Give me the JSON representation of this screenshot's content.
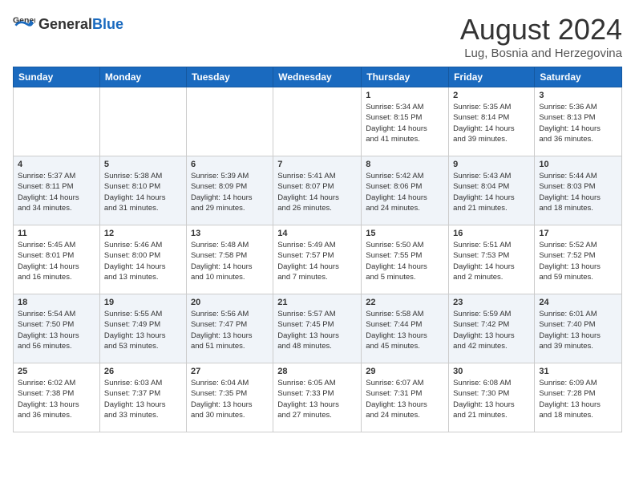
{
  "header": {
    "logo_general": "General",
    "logo_blue": "Blue",
    "month_year": "August 2024",
    "location": "Lug, Bosnia and Herzegovina"
  },
  "days_of_week": [
    "Sunday",
    "Monday",
    "Tuesday",
    "Wednesday",
    "Thursday",
    "Friday",
    "Saturday"
  ],
  "weeks": [
    [
      {
        "day": "",
        "content": ""
      },
      {
        "day": "",
        "content": ""
      },
      {
        "day": "",
        "content": ""
      },
      {
        "day": "",
        "content": ""
      },
      {
        "day": "1",
        "content": "Sunrise: 5:34 AM\nSunset: 8:15 PM\nDaylight: 14 hours\nand 41 minutes."
      },
      {
        "day": "2",
        "content": "Sunrise: 5:35 AM\nSunset: 8:14 PM\nDaylight: 14 hours\nand 39 minutes."
      },
      {
        "day": "3",
        "content": "Sunrise: 5:36 AM\nSunset: 8:13 PM\nDaylight: 14 hours\nand 36 minutes."
      }
    ],
    [
      {
        "day": "4",
        "content": "Sunrise: 5:37 AM\nSunset: 8:11 PM\nDaylight: 14 hours\nand 34 minutes."
      },
      {
        "day": "5",
        "content": "Sunrise: 5:38 AM\nSunset: 8:10 PM\nDaylight: 14 hours\nand 31 minutes."
      },
      {
        "day": "6",
        "content": "Sunrise: 5:39 AM\nSunset: 8:09 PM\nDaylight: 14 hours\nand 29 minutes."
      },
      {
        "day": "7",
        "content": "Sunrise: 5:41 AM\nSunset: 8:07 PM\nDaylight: 14 hours\nand 26 minutes."
      },
      {
        "day": "8",
        "content": "Sunrise: 5:42 AM\nSunset: 8:06 PM\nDaylight: 14 hours\nand 24 minutes."
      },
      {
        "day": "9",
        "content": "Sunrise: 5:43 AM\nSunset: 8:04 PM\nDaylight: 14 hours\nand 21 minutes."
      },
      {
        "day": "10",
        "content": "Sunrise: 5:44 AM\nSunset: 8:03 PM\nDaylight: 14 hours\nand 18 minutes."
      }
    ],
    [
      {
        "day": "11",
        "content": "Sunrise: 5:45 AM\nSunset: 8:01 PM\nDaylight: 14 hours\nand 16 minutes."
      },
      {
        "day": "12",
        "content": "Sunrise: 5:46 AM\nSunset: 8:00 PM\nDaylight: 14 hours\nand 13 minutes."
      },
      {
        "day": "13",
        "content": "Sunrise: 5:48 AM\nSunset: 7:58 PM\nDaylight: 14 hours\nand 10 minutes."
      },
      {
        "day": "14",
        "content": "Sunrise: 5:49 AM\nSunset: 7:57 PM\nDaylight: 14 hours\nand 7 minutes."
      },
      {
        "day": "15",
        "content": "Sunrise: 5:50 AM\nSunset: 7:55 PM\nDaylight: 14 hours\nand 5 minutes."
      },
      {
        "day": "16",
        "content": "Sunrise: 5:51 AM\nSunset: 7:53 PM\nDaylight: 14 hours\nand 2 minutes."
      },
      {
        "day": "17",
        "content": "Sunrise: 5:52 AM\nSunset: 7:52 PM\nDaylight: 13 hours\nand 59 minutes."
      }
    ],
    [
      {
        "day": "18",
        "content": "Sunrise: 5:54 AM\nSunset: 7:50 PM\nDaylight: 13 hours\nand 56 minutes."
      },
      {
        "day": "19",
        "content": "Sunrise: 5:55 AM\nSunset: 7:49 PM\nDaylight: 13 hours\nand 53 minutes."
      },
      {
        "day": "20",
        "content": "Sunrise: 5:56 AM\nSunset: 7:47 PM\nDaylight: 13 hours\nand 51 minutes."
      },
      {
        "day": "21",
        "content": "Sunrise: 5:57 AM\nSunset: 7:45 PM\nDaylight: 13 hours\nand 48 minutes."
      },
      {
        "day": "22",
        "content": "Sunrise: 5:58 AM\nSunset: 7:44 PM\nDaylight: 13 hours\nand 45 minutes."
      },
      {
        "day": "23",
        "content": "Sunrise: 5:59 AM\nSunset: 7:42 PM\nDaylight: 13 hours\nand 42 minutes."
      },
      {
        "day": "24",
        "content": "Sunrise: 6:01 AM\nSunset: 7:40 PM\nDaylight: 13 hours\nand 39 minutes."
      }
    ],
    [
      {
        "day": "25",
        "content": "Sunrise: 6:02 AM\nSunset: 7:38 PM\nDaylight: 13 hours\nand 36 minutes."
      },
      {
        "day": "26",
        "content": "Sunrise: 6:03 AM\nSunset: 7:37 PM\nDaylight: 13 hours\nand 33 minutes."
      },
      {
        "day": "27",
        "content": "Sunrise: 6:04 AM\nSunset: 7:35 PM\nDaylight: 13 hours\nand 30 minutes."
      },
      {
        "day": "28",
        "content": "Sunrise: 6:05 AM\nSunset: 7:33 PM\nDaylight: 13 hours\nand 27 minutes."
      },
      {
        "day": "29",
        "content": "Sunrise: 6:07 AM\nSunset: 7:31 PM\nDaylight: 13 hours\nand 24 minutes."
      },
      {
        "day": "30",
        "content": "Sunrise: 6:08 AM\nSunset: 7:30 PM\nDaylight: 13 hours\nand 21 minutes."
      },
      {
        "day": "31",
        "content": "Sunrise: 6:09 AM\nSunset: 7:28 PM\nDaylight: 13 hours\nand 18 minutes."
      }
    ]
  ]
}
